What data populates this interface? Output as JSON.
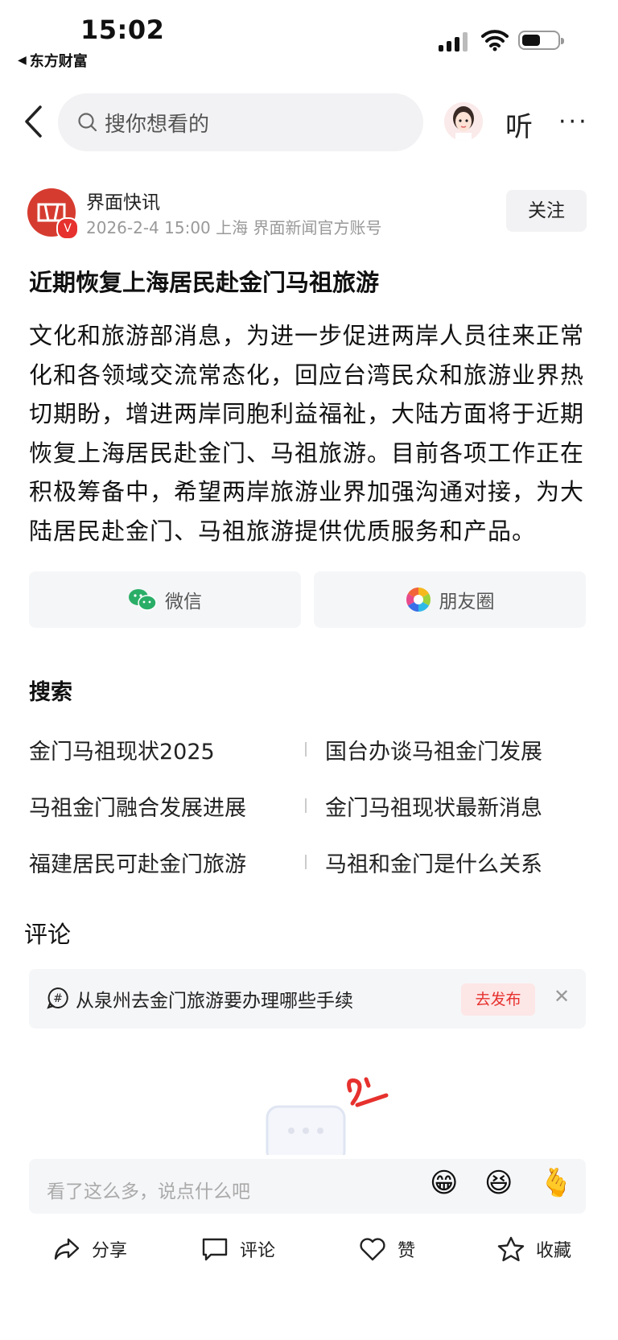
{
  "status_bar": {
    "time": "15:02",
    "back_app": "东方财富"
  },
  "nav": {
    "search_placeholder": "搜你想看的",
    "listen_label": "听",
    "more_label": "···"
  },
  "author": {
    "name": "界面快讯",
    "meta": "2026-2-4  15:00  上海  界面新闻官方账号",
    "verified_badge": "V",
    "follow_label": "关注"
  },
  "article": {
    "title": "近期恢复上海居民赴金门马祖旅游",
    "body": "文化和旅游部消息，为进一步促进两岸人员往来正常化和各领域交流常态化，回应台湾民众和旅游业界热切期盼，增进两岸同胞利益福祉，大陆方面将于近期恢复上海居民赴金门、马祖旅游。目前各项工作正在积极筹备中，希望两岸旅游业界加强沟通对接，为大陆居民赴金门、马祖旅游提供优质服务和产品。"
  },
  "share": {
    "wechat_label": "微信",
    "moments_label": "朋友圈"
  },
  "search_section": {
    "title": "搜索",
    "items": [
      "金门马祖现状2025",
      "国台办谈马祖金门发展",
      "马祖金门融合发展进展",
      "金门马祖现状最新消息",
      "福建居民可赴金门旅游",
      "马祖和金门是什么关系"
    ]
  },
  "comments": {
    "title": "评论",
    "topic_text": "从泉州去金门旅游要办理哪些手续",
    "topic_action": "去发布",
    "input_placeholder": "看了这么多，说点什么吧",
    "emojis": [
      "😁",
      "😆",
      "🫰"
    ]
  },
  "bottom_bar": {
    "share": "分享",
    "comment": "评论",
    "like": "赞",
    "collect": "收藏"
  },
  "colors": {
    "accent_red": "#e6312e",
    "wechat_green": "#2aae67"
  }
}
